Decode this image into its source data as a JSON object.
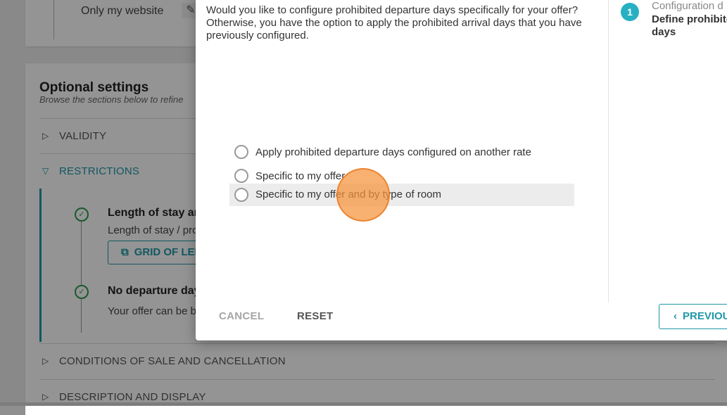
{
  "background": {
    "top_card": {
      "text": "Only my website",
      "edit_icon": "pencil-icon"
    },
    "optional_settings": {
      "title": "Optional settings",
      "subtitle": "Browse the sections below to refine",
      "sections": [
        {
          "label": "VALIDITY",
          "state": "collapsed"
        },
        {
          "label": "RESTRICTIONS",
          "state": "expanded"
        },
        {
          "label": "CONDITIONS OF SALE AND CANCELLATION",
          "state": "collapsed"
        },
        {
          "label": "DESCRIPTION AND DISPLAY",
          "state": "collapsed"
        }
      ],
      "restrictions": {
        "item1_title": "Length of stay and",
        "item1_text": "Length of stay / proh",
        "grid_button": "GRID OF LENGT",
        "item2_title": "No departure days",
        "item2_text": "Your offer can be boo"
      }
    }
  },
  "modal": {
    "question": "Would you like to configure prohibited departure days specifically for your offer? Otherwise, you have the option to apply the prohibited arrival days that you have previously configured.",
    "options": [
      {
        "label": "Apply prohibited departure days configured on another rate",
        "selected": false
      },
      {
        "label": "Specific to my offer",
        "selected": false
      },
      {
        "label": "Specific to my offer and by type of room",
        "selected": false,
        "highlighted": true
      }
    ],
    "footer": {
      "cancel": "CANCEL",
      "reset": "RESET",
      "previous": "PREVIOU"
    },
    "stepper": {
      "number": "1",
      "caption": "Configuration d",
      "title": "Define prohibite days"
    }
  },
  "colors": {
    "accent": "#1f97a8",
    "step_badge": "#26b0c2",
    "success": "#2e9a4d",
    "click_indicator": "#f7933c"
  }
}
